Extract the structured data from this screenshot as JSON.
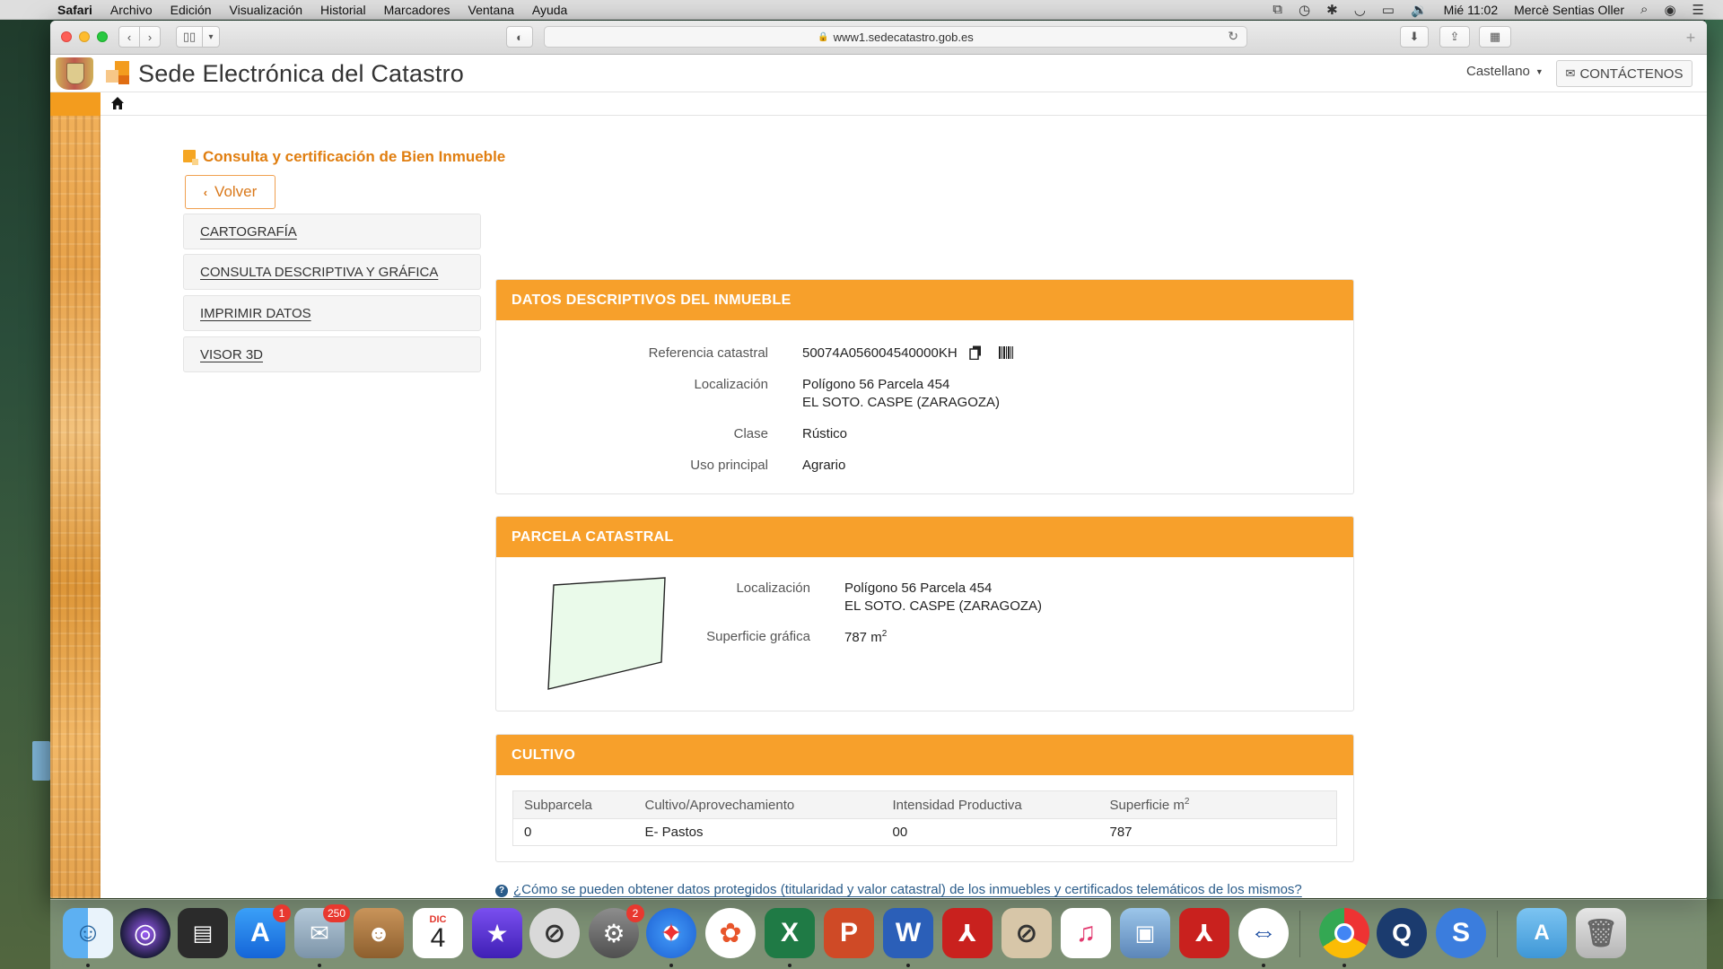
{
  "menubar": {
    "app": "Safari",
    "items": [
      "Archivo",
      "Edición",
      "Visualización",
      "Historial",
      "Marcadores",
      "Ventana",
      "Ayuda"
    ],
    "clock": "Mié 11:02",
    "user": "Mercè Sentias Oller"
  },
  "browser": {
    "url": "www1.sedecatastro.gob.es"
  },
  "site": {
    "title": "Sede Electrónica del Catastro",
    "language": "Castellano",
    "contact_label": "CONTÁCTENOS"
  },
  "page": {
    "heading": "Consulta y certificación de Bien Inmueble",
    "back_label": "Volver"
  },
  "sidebar": {
    "items": [
      {
        "label": "CARTOGRAFÍA"
      },
      {
        "label": "CONSULTA DESCRIPTIVA Y GRÁFICA"
      },
      {
        "label": "IMPRIMIR DATOS"
      },
      {
        "label": "VISOR 3D"
      }
    ]
  },
  "datos": {
    "title": "DATOS DESCRIPTIVOS DEL INMUEBLE",
    "ref_label": "Referencia catastral",
    "ref_value": "50074A056004540000KH",
    "loc_label": "Localización",
    "loc_line1": "Polígono 56 Parcela 454",
    "loc_line2": "EL SOTO. CASPE (ZARAGOZA)",
    "clase_label": "Clase",
    "clase_value": "Rústico",
    "uso_label": "Uso principal",
    "uso_value": "Agrario"
  },
  "parcela": {
    "title": "PARCELA CATASTRAL",
    "loc_label": "Localización",
    "loc_line1": "Polígono 56 Parcela 454",
    "loc_line2": "EL SOTO. CASPE (ZARAGOZA)",
    "sup_label": "Superficie gráfica",
    "sup_value": "787 m",
    "sup_exp": "2"
  },
  "cultivo": {
    "title": "CULTIVO",
    "headers": [
      "Subparcela",
      "Cultivo/Aprovechamiento",
      "Intensidad Productiva",
      "Superficie m"
    ],
    "header_exp": "2",
    "rows": [
      [
        "0",
        "E- Pastos",
        "00",
        "787"
      ]
    ]
  },
  "help": {
    "text": "¿Cómo se pueden obtener datos protegidos (titularidad y valor catastral) de los inmuebles y certificados telemáticos de los mismos?"
  },
  "dock": {
    "mail_badge": "250",
    "appstore_badge": "1",
    "prefs_badge": "2",
    "calendar_month": "DIC",
    "calendar_day": "4"
  },
  "colors": {
    "accent_orange": "#f7a02b",
    "heading_orange": "#e07e10",
    "link_blue": "#2a5c8a"
  }
}
